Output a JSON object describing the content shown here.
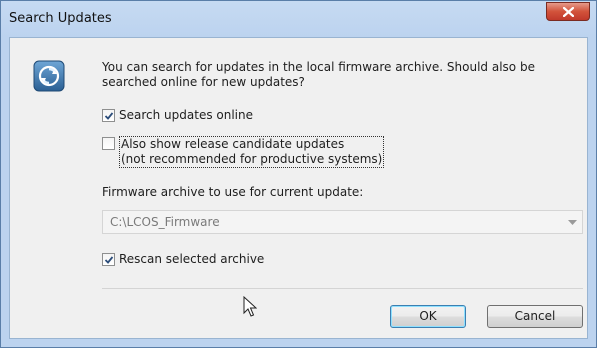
{
  "window": {
    "title": "Search Updates",
    "close_label": "X"
  },
  "dialog": {
    "intro_text": "You can search for updates in the local firmware archive. Should also be searched online for new updates?",
    "search_online": {
      "label": "Search updates online",
      "checked": true
    },
    "release_candidate": {
      "label_line1": "Also show release candidate updates",
      "label_line2": "(not recommended for productive systems)",
      "checked": false
    },
    "archive_label": "Firmware archive to use for current update:",
    "archive_value": "C:\\LCOS_Firmware",
    "rescan": {
      "label": "Rescan selected archive",
      "checked": true
    },
    "ok_label": "OK",
    "cancel_label": "Cancel"
  },
  "icons": {
    "app": "firmware-update-icon",
    "close": "close-icon",
    "dropdown": "chevron-down-icon",
    "cursor": "mouse-pointer-icon"
  }
}
